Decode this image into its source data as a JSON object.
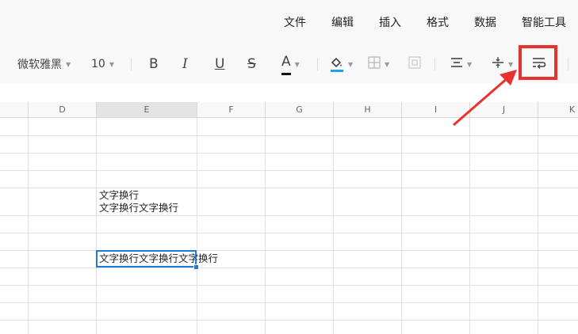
{
  "menubar": {
    "items": [
      "文件",
      "编辑",
      "插入",
      "格式",
      "数据",
      "智能工具"
    ]
  },
  "toolbar": {
    "font_family": "微软雅黑",
    "font_size": "10",
    "bold_label": "B",
    "italic_label": "I",
    "underline_label": "U",
    "strike_label": "S",
    "font_color_label": "A",
    "font_color": "#111111",
    "fill_color": "#1aa3e8",
    "highlight_color": "#e8322f"
  },
  "grid": {
    "columns": [
      "D",
      "E",
      "F",
      "G",
      "H",
      "I",
      "J",
      "K"
    ],
    "selected_column": "E",
    "cells": {
      "e_line1": "文字换行",
      "e_line2": "文字换行文字换行",
      "active": "文字换行文字换行文字换行"
    }
  },
  "colors": {
    "accent": "#1f7ad8",
    "annotation": "#e8322f"
  }
}
